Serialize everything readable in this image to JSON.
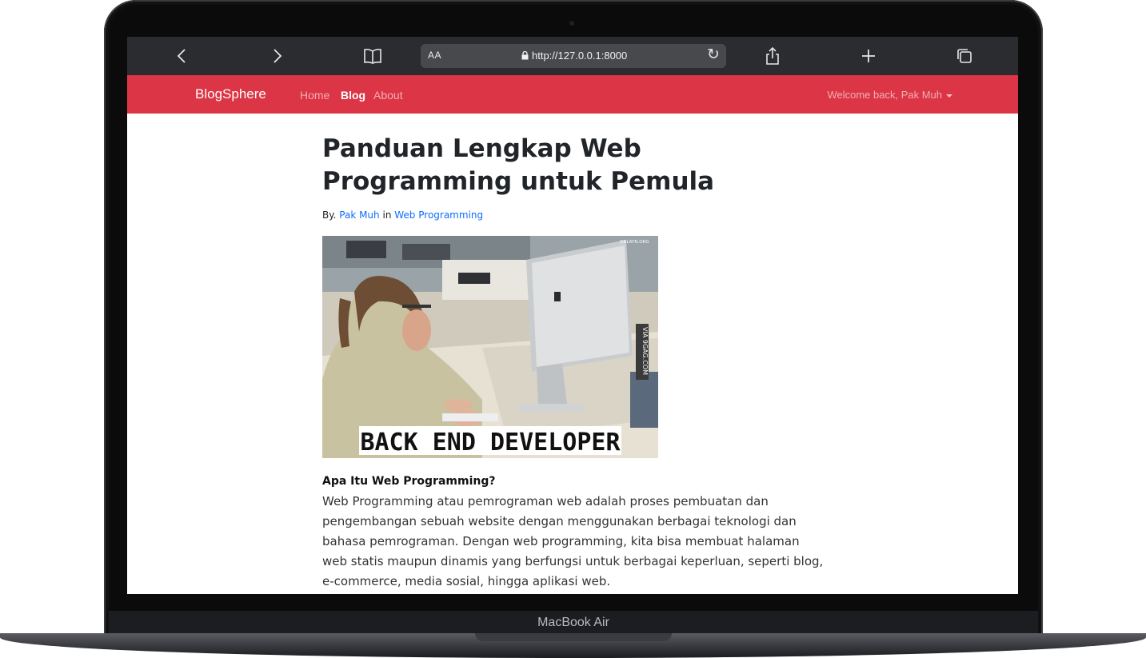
{
  "device": {
    "label": "MacBook Air"
  },
  "browser": {
    "text_size_label": "AA",
    "url": "http://127.0.0.1:8000",
    "icons": [
      "back-icon",
      "forward-icon",
      "bookmarks-icon",
      "lock-icon",
      "reload-icon",
      "share-icon",
      "new-tab-icon",
      "tabs-icon"
    ]
  },
  "navbar": {
    "brand": "BlogSphere",
    "links": [
      {
        "label": "Home",
        "active": false
      },
      {
        "label": "Blog",
        "active": true
      },
      {
        "label": "About",
        "active": false
      }
    ],
    "welcome": "Welcome back, Pak Muh",
    "color": "#dc3545"
  },
  "article": {
    "title": "Panduan Lengkap Web Programming untuk Pemula",
    "by_prefix": "By.",
    "author": "Pak Muh",
    "in_word": "in",
    "category": "Web Programming",
    "image": {
      "caption": "BACK END DEVELOPER",
      "watermark_side": "VIA 9GAG.COM",
      "watermark_top": "ONLAYN.ORG"
    },
    "section_heading": "Apa Itu Web Programming?",
    "paragraph": "Web Programming atau pemrograman web adalah proses pembuatan dan pengembangan sebuah website dengan menggunakan berbagai teknologi dan bahasa pemrograman. Dengan web programming, kita bisa membuat halaman web statis maupun dinamis yang berfungsi untuk berbagai keperluan, seperti blog, e-commerce, media sosial, hingga aplikasi web."
  },
  "colors": {
    "link": "#0d6efd",
    "toolbar": "#2b2c2f"
  }
}
